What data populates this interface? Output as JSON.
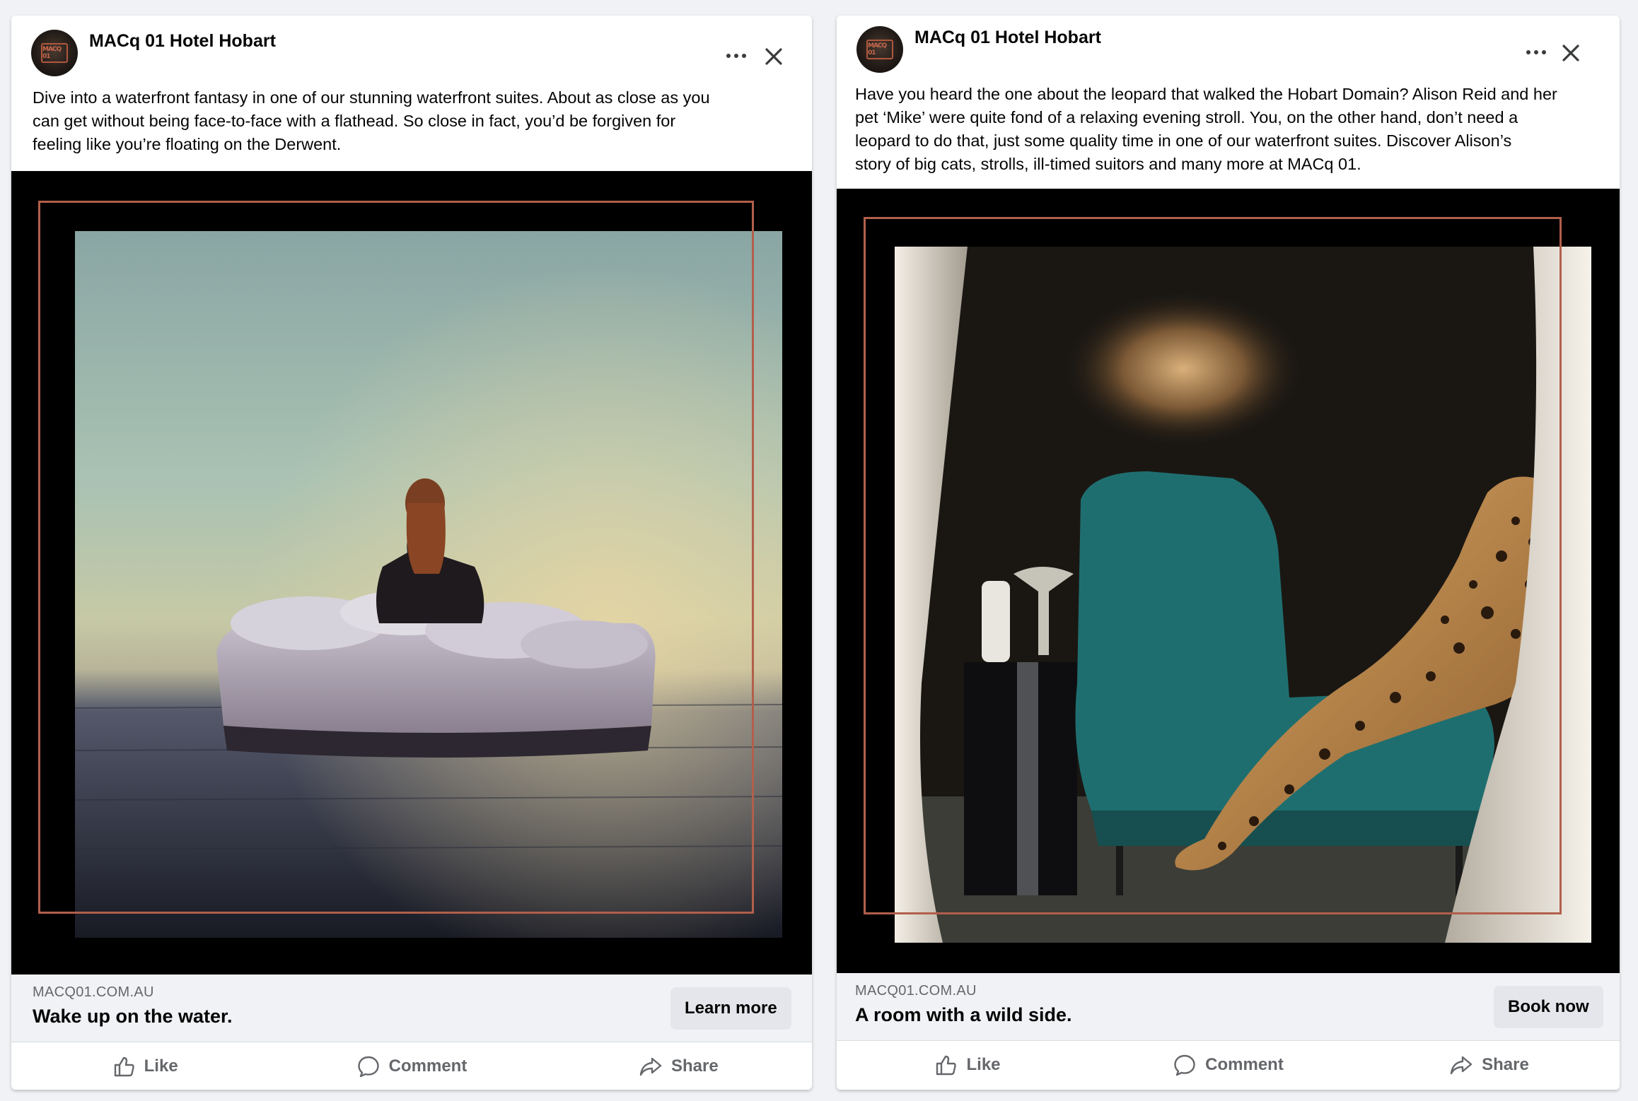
{
  "posts": [
    {
      "page_name": "MACq 01 Hotel Hobart",
      "avatar_logo": "MACQ 01",
      "text_lines": [
        "Dive into a waterfront fantasy in one of our stunning waterfront suites. About as close as you",
        "can get without being face-to-face with a flathead. So close in fact, you’d be forgiven for",
        "feeling like you’re floating on the Derwent."
      ],
      "image_description_icon": "woman-on-floating-bed-image",
      "domain": "MACQ01.COM.AU",
      "headline": "Wake up on the water.",
      "cta_label": "Learn more",
      "actions": {
        "like": "Like",
        "comment": "Comment",
        "share": "Share"
      }
    },
    {
      "page_name": "MACq 01 Hotel Hobart",
      "avatar_logo": "MACQ 01",
      "text_lines": [
        "Have you heard the one about the leopard that walked the Hobart Domain? Alison Reid and her",
        "pet ‘Mike’ were quite fond of a relaxing evening stroll. You, on the other hand, don’t need a",
        "leopard to do that, just some quality time in one of our waterfront suites. Discover Alison’s",
        "story of big cats, strolls, ill-timed suitors and many more at MACq 01."
      ],
      "image_description_icon": "leopard-on-armchair-image",
      "domain": "MACQ01.COM.AU",
      "headline": "A room with a wild side.",
      "cta_label": "Book now",
      "actions": {
        "like": "Like",
        "comment": "Comment",
        "share": "Share"
      }
    }
  ],
  "colors": {
    "frame_accent": "#b25f4b",
    "page_background": "#f0f2f5",
    "text_primary": "#050505",
    "text_secondary": "#65676b"
  },
  "icons": [
    "more-options-icon",
    "close-icon",
    "like-thumb-icon",
    "comment-bubble-icon",
    "share-arrow-icon"
  ]
}
